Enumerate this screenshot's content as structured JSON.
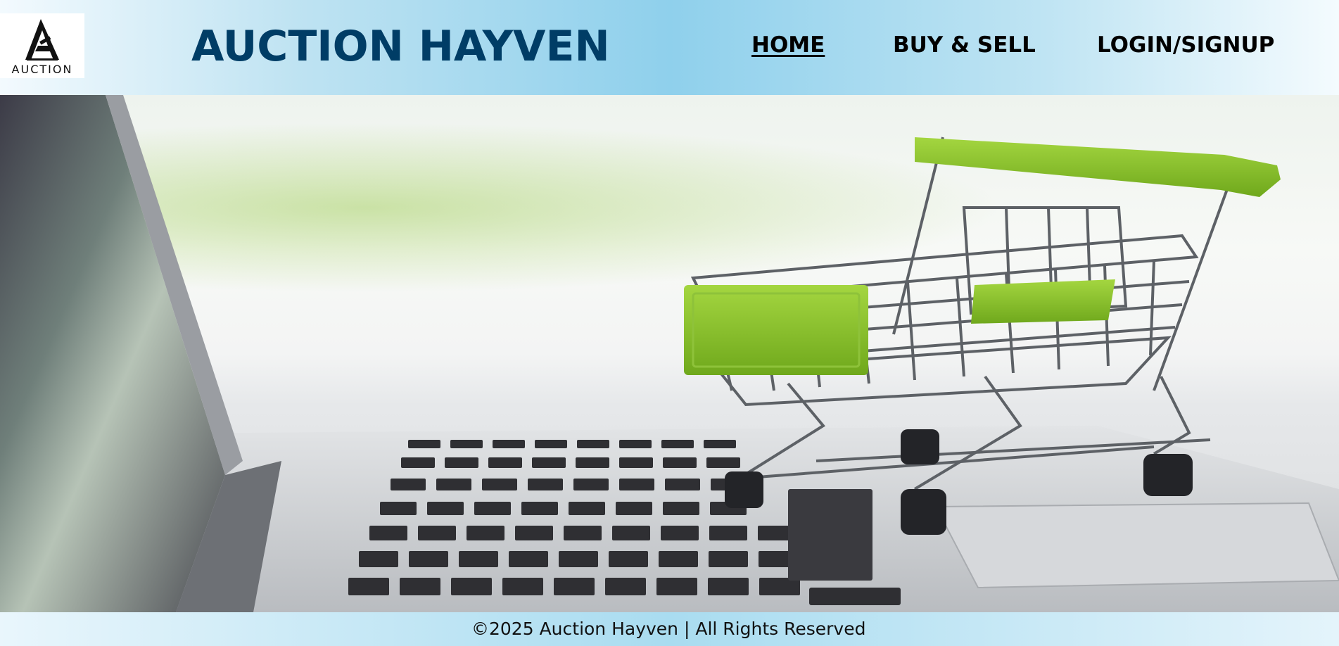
{
  "header": {
    "logo_text": "AUCTION",
    "logo_icon": "gavel-a-icon",
    "title": "AUCTION HAYVEN",
    "title_color": "#003d66"
  },
  "nav": {
    "items": [
      {
        "label": "HOME",
        "active": true
      },
      {
        "label": "BUY & SELL",
        "active": false
      },
      {
        "label": "LOGIN/SIGNUP",
        "active": false
      }
    ]
  },
  "hero": {
    "image": "shopping-cart-on-laptop-keyboard",
    "accent_color": "#8cc63f"
  },
  "footer": {
    "text": "©2025 Auction Hayven | All Rights Reserved"
  }
}
